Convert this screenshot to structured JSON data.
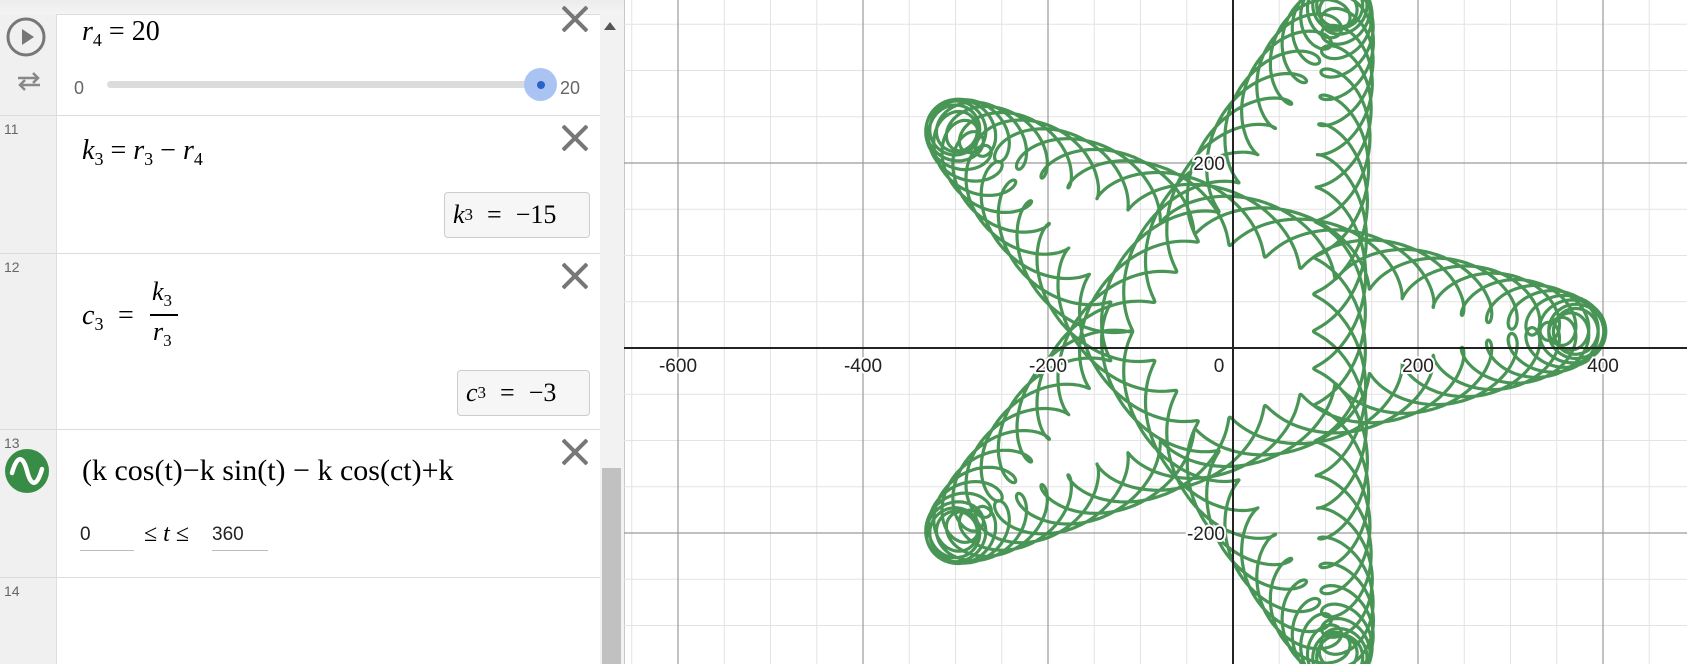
{
  "expressions": {
    "row10": {
      "lhs": "r",
      "lhs_sub": "4",
      "equals": "=",
      "value": "20",
      "slider": {
        "min_label": "0",
        "max_label": "20",
        "value": 20,
        "fraction": 1.0
      }
    },
    "row11": {
      "number": "11",
      "formula": {
        "lhs": "k",
        "lhs_sub": "3",
        "eq": "=",
        "a": "r",
        "a_sub": "3",
        "op": "−",
        "b": "r",
        "b_sub": "4"
      },
      "result": {
        "var": "k",
        "sub": "3",
        "eq": "=",
        "value": "−15"
      }
    },
    "row12": {
      "number": "12",
      "formula": {
        "lhs": "c",
        "lhs_sub": "3",
        "eq": "=",
        "num": "k",
        "num_sub": "3",
        "den": "r",
        "den_sub": "3"
      },
      "result": {
        "var": "c",
        "sub": "3",
        "eq": "=",
        "value": "−3"
      }
    },
    "row13": {
      "number": "13",
      "parametric_text": "(k cos(t)−k sin(t) − k cos(ct)+k",
      "domain": {
        "min": "0",
        "leq1": "≤",
        "var": "t",
        "leq2": "≤",
        "max": "360"
      },
      "color": "#388c46"
    },
    "row14": {
      "number": "14"
    }
  },
  "graph": {
    "x_ticks": [
      "-600",
      "-400",
      "-200",
      "0",
      "200",
      "400"
    ],
    "y_ticks": [
      "200",
      "-200"
    ],
    "curve_color": "#388c46",
    "grid_major_color": "#9a9a9a",
    "grid_minor_color": "#e3e3e3",
    "axis_color": "#222222"
  }
}
